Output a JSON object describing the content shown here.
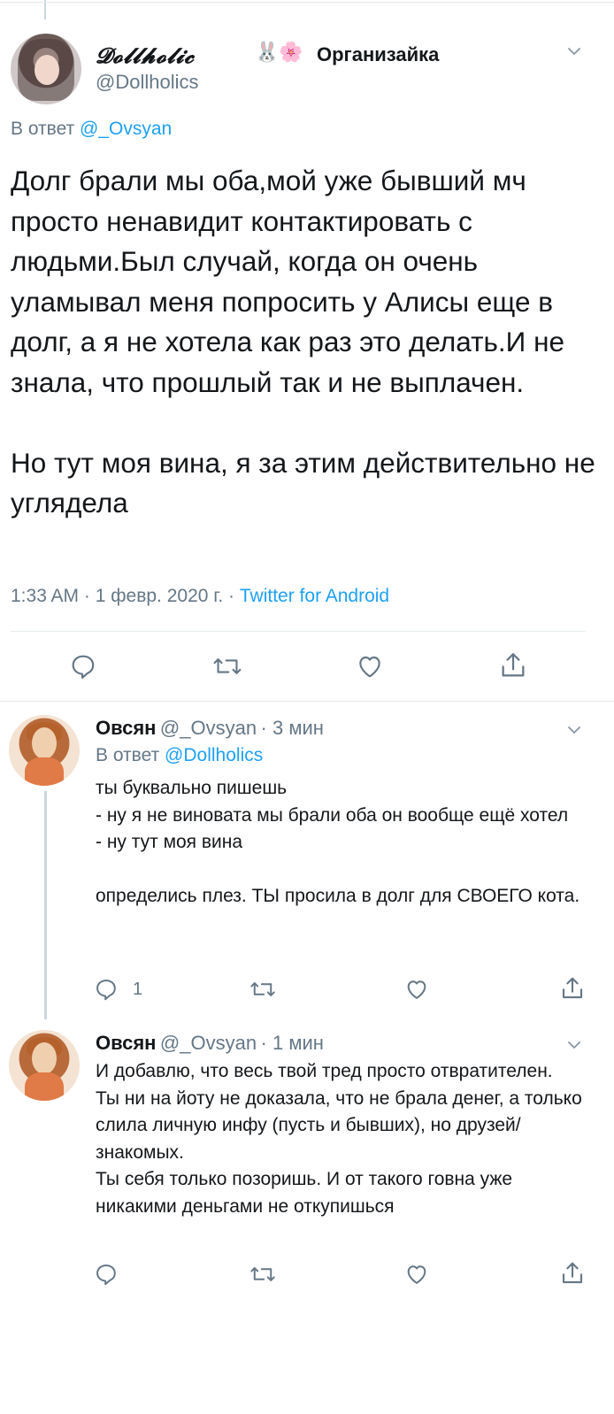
{
  "main_tweet": {
    "display_name": "𝓓𝓸𝓵𝓵𝓱𝓸𝓵𝓲𝓬",
    "name_emoji": "🐰🌸",
    "name_extra": "Организайка",
    "handle": "@Dollholics",
    "reply_prefix": "В ответ",
    "reply_handle": "@_Ovsyan",
    "text_p1": "Долг брали мы оба,мой уже бывший мч просто ненавидит контактировать с людьми.Был случай, когда он очень уламывал меня попросить у Алисы еще в долг, а я не хотела как раз это делать.И не знала, что прошлый так и не выплачен.",
    "text_p2": "Но тут моя вина, я за этим действительно не углядела",
    "time": "1:33 AM",
    "date": "1 февр. 2020 г.",
    "source": "Twitter for Android"
  },
  "replies": [
    {
      "name": "Овсян",
      "handle": "@_Ovsyan",
      "time": "3 мин",
      "reply_prefix": "В ответ",
      "reply_handle": "@Dollholics",
      "lines": [
        "ты буквально пишешь",
        "- ну я не виновата мы брали оба он вообще ещё хотел",
        "- ну тут моя вина"
      ],
      "lines2": [
        "определись плез. ТЫ просила в долг для СВОЕГО кота."
      ],
      "reply_count": "1"
    },
    {
      "name": "Овсян",
      "handle": "@_Ovsyan",
      "time": "1 мин",
      "lines": [
        "И добавлю, что весь твой тред просто отвратителен.",
        "Ты ни на йоту не доказала, что не брала денег, а только слила личную инфу (пусть и бывших), но друзей/знакомых.",
        "Ты себя только позоришь. И от такого говна уже никакими деньгами не откупишься"
      ]
    }
  ],
  "colors": {
    "accent": "#1da1f2",
    "secondary_text": "#657786",
    "divider": "#e6ecf0",
    "icon": "#657786"
  },
  "icons": {
    "reply": "speech-bubble-icon",
    "retweet": "retweet-icon",
    "like": "heart-icon",
    "share": "share-icon",
    "more": "chevron-down-icon"
  }
}
